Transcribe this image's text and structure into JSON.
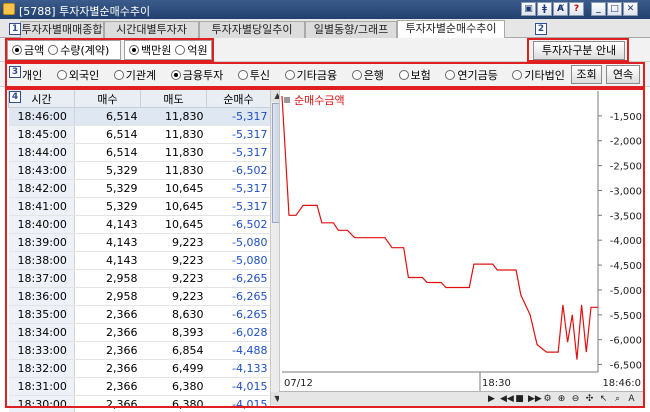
{
  "window": {
    "title": "[5788]  투자자별순매수추이"
  },
  "tabs": [
    "투자자별매매종합",
    "시간대별투자자",
    "투자자별당일추이",
    "일별동향/그래프",
    "투자자별순매수추이"
  ],
  "options": {
    "unit_type": [
      "금액",
      "수량(계약)"
    ],
    "unit_type_selected": "금액",
    "money_unit": [
      "백만원",
      "억원"
    ],
    "money_unit_selected": "백만원",
    "guide_button": "투자자구분 안내"
  },
  "investors": {
    "items": [
      "개인",
      "외국인",
      "기관계",
      "금융투자",
      "투신",
      "기타금융",
      "은행",
      "보험",
      "연기금등",
      "기타법인"
    ],
    "selected": "금융투자",
    "query_button": "조회",
    "continue_button": "연속"
  },
  "markers": [
    "1",
    "2",
    "3",
    "4"
  ],
  "table": {
    "columns": [
      "시간",
      "매수",
      "매도",
      "순매수"
    ],
    "rows": [
      [
        "18:46:00",
        "6,514",
        "11,830",
        "-5,317"
      ],
      [
        "18:45:00",
        "6,514",
        "11,830",
        "-5,317"
      ],
      [
        "18:44:00",
        "6,514",
        "11,830",
        "-5,317"
      ],
      [
        "18:43:00",
        "5,329",
        "11,830",
        "-6,502"
      ],
      [
        "18:42:00",
        "5,329",
        "10,645",
        "-5,317"
      ],
      [
        "18:41:00",
        "5,329",
        "10,645",
        "-5,317"
      ],
      [
        "18:40:00",
        "4,143",
        "10,645",
        "-6,502"
      ],
      [
        "18:39:00",
        "4,143",
        "9,223",
        "-5,080"
      ],
      [
        "18:38:00",
        "4,143",
        "9,223",
        "-5,080"
      ],
      [
        "18:37:00",
        "2,958",
        "9,223",
        "-6,265"
      ],
      [
        "18:36:00",
        "2,958",
        "9,223",
        "-6,265"
      ],
      [
        "18:35:00",
        "2,366",
        "8,630",
        "-6,265"
      ],
      [
        "18:34:00",
        "2,366",
        "8,393",
        "-6,028"
      ],
      [
        "18:33:00",
        "2,366",
        "6,854",
        "-4,488"
      ],
      [
        "18:32:00",
        "2,366",
        "6,499",
        "-4,133"
      ],
      [
        "18:31:00",
        "2,366",
        "6,380",
        "-4,015"
      ],
      [
        "18:30:00",
        "2,366",
        "6,380",
        "-4,015"
      ]
    ]
  },
  "chart_data": {
    "type": "line",
    "legend": "순매수금액",
    "y_ticks": [
      "-1,500",
      "-2,000",
      "-2,500",
      "-3,000",
      "-3,500",
      "-4,000",
      "-4,500",
      "-5,000",
      "-5,500",
      "-6,000",
      "-6,500"
    ],
    "ylim": [
      -6650,
      -1000
    ],
    "x_labels": [
      "07/12",
      "18:30",
      "18:46:0"
    ],
    "series": [
      {
        "name": "순매수금액",
        "color": "#e01010",
        "points": [
          [
            0,
            -1100
          ],
          [
            3,
            -3500
          ],
          [
            6,
            -3500
          ],
          [
            9,
            -3300
          ],
          [
            15,
            -3300
          ],
          [
            17,
            -3650
          ],
          [
            22,
            -3650
          ],
          [
            24,
            -3800
          ],
          [
            28,
            -3800
          ],
          [
            31,
            -3950
          ],
          [
            44,
            -3950
          ],
          [
            47,
            -4150
          ],
          [
            52,
            -4150
          ],
          [
            54,
            -4750
          ],
          [
            60,
            -4750
          ],
          [
            62,
            -4850
          ],
          [
            68,
            -4850
          ],
          [
            70,
            -4950
          ],
          [
            80,
            -4950
          ],
          [
            82,
            -4480
          ],
          [
            90,
            -4480
          ],
          [
            92,
            -4600
          ],
          [
            100,
            -4600
          ],
          [
            102,
            -5100
          ],
          [
            106,
            -5500
          ],
          [
            109,
            -6100
          ],
          [
            113,
            -6250
          ],
          [
            118,
            -6250
          ],
          [
            120,
            -5300
          ],
          [
            122,
            -6050
          ],
          [
            124,
            -5500
          ],
          [
            126,
            -6400
          ],
          [
            128,
            -5300
          ],
          [
            130,
            -6250
          ],
          [
            132,
            -5350
          ],
          [
            135,
            -5350
          ]
        ]
      }
    ]
  },
  "icons": [
    "app-icon",
    "window-restore-icon",
    "pin-icon",
    "formula-icon",
    "help-icon",
    "minimize-icon",
    "maximize-icon",
    "close-icon"
  ]
}
